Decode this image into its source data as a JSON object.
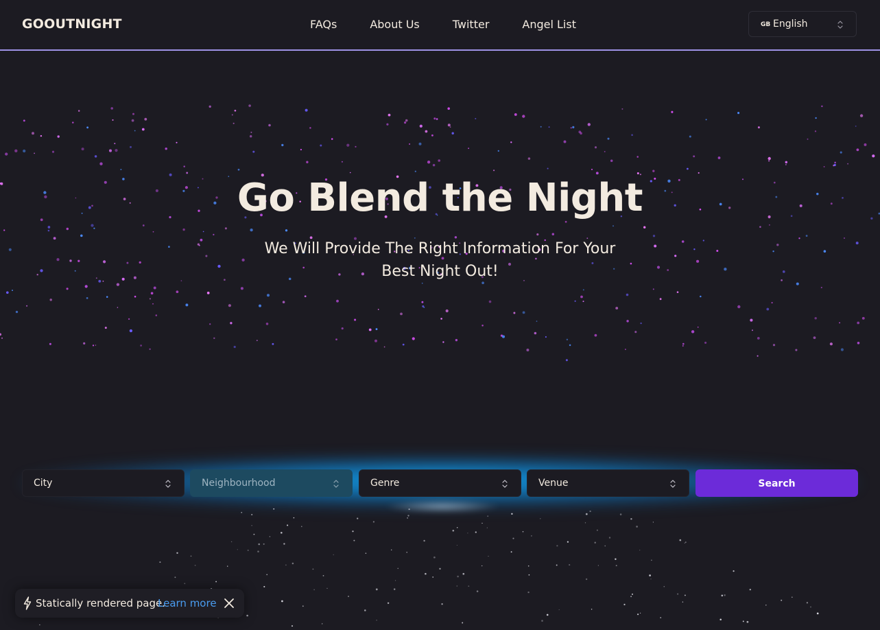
{
  "header": {
    "logo": "GOOUTNIGHT",
    "nav": [
      "FAQs",
      "About Us",
      "Twitter",
      "Angel List"
    ],
    "language": {
      "flag": "GB",
      "label": "English"
    }
  },
  "hero": {
    "title": "Go Blend the Night",
    "subtitle": "We Will Provide The Right Information For Your Best Night Out!"
  },
  "search": {
    "city_placeholder": "City",
    "neighbourhood_placeholder": "Neighbourhood",
    "genre_placeholder": "Genre",
    "venue_placeholder": "Venue",
    "search_label": "Search"
  },
  "toast": {
    "message": "Statically rendered page.",
    "link": "Learn more"
  },
  "colors": {
    "background": "#1c1b22",
    "text": "#f3ebe0",
    "accent_purple": "#6c2bd9",
    "header_border": "#9f93e6",
    "glow_blue": "#14aaf5",
    "link_blue": "#4a9cf0"
  },
  "icons": {
    "language_select": "chevron-up-down-icon",
    "select": "chevron-up-down-icon",
    "toast": "lightning-bolt-icon",
    "toast_close": "close-icon"
  }
}
